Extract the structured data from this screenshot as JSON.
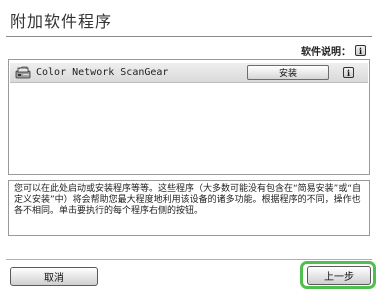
{
  "dialog": {
    "title": "附加软件程序",
    "help_label": "软件说明：",
    "info_glyph": "i"
  },
  "software_list": [
    {
      "name": "Color Network ScanGear",
      "install_label": "安装",
      "info_glyph": "i",
      "icon": "scanner-app-icon"
    }
  ],
  "description": "您可以在此处启动或安装程序等等。这些程序（大多数可能没有包含在“简易安装”或“自定义安装”中）将会帮助您最大程度地利用该设备的诸多功能。根据程序的不同，操作也各不相同。单击要执行的每个程序右侧的按钮。",
  "footer": {
    "cancel_label": "取消",
    "back_label": "上一步"
  },
  "colors": {
    "focus_ring": "#4ec04e"
  }
}
